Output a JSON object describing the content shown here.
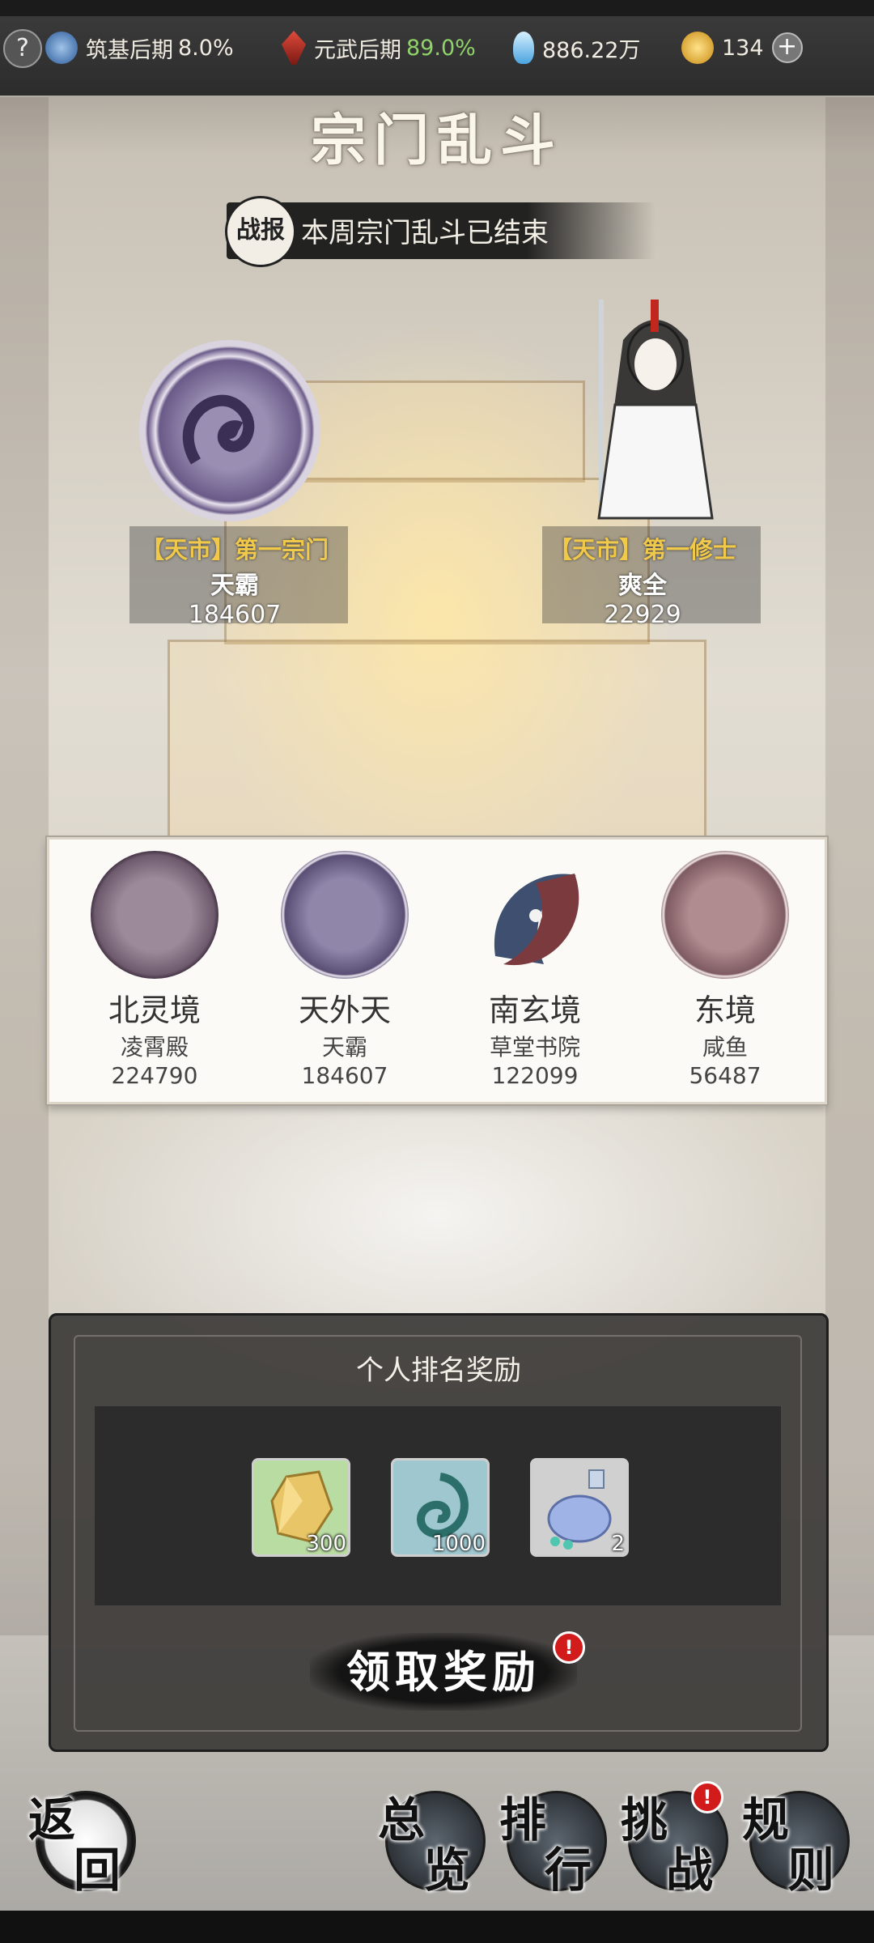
{
  "topbar": {
    "help_label": "?",
    "realm1": {
      "name": "筑基后期",
      "progress": "8.0%"
    },
    "realm2": {
      "name": "元武后期",
      "progress": "89.0%"
    },
    "spirit_stones": "886.22万",
    "jade": "134",
    "plus_label": "+"
  },
  "title": "宗门乱斗",
  "banner": {
    "seal": "战报",
    "text": "本周宗门乱斗已结束"
  },
  "champions": {
    "sect": {
      "title": "【天市】第一宗门",
      "name": "天霸",
      "score": "184607"
    },
    "cultivator": {
      "title": "【天市】第一修士",
      "name": "爽全",
      "score": "22929"
    }
  },
  "sects": [
    {
      "region": "北灵境",
      "name": "凌霄殿",
      "score": "224790",
      "color": "#6e5a6d"
    },
    {
      "region": "天外天",
      "name": "天霸",
      "score": "184607",
      "color": "#5a4e74"
    },
    {
      "region": "南玄境",
      "name": "草堂书院",
      "score": "122099",
      "color": "#3e4f70"
    },
    {
      "region": "东境",
      "name": "咸鱼",
      "score": "56487",
      "color": "#7e5a62"
    }
  ],
  "reward": {
    "title": "个人排名奖励",
    "items": [
      {
        "icon": "crystal-icon",
        "count": "300",
        "bg": "#b9dca2"
      },
      {
        "icon": "spirit-swirl-icon",
        "count": "1000",
        "bg": "#9ec7cf"
      },
      {
        "icon": "potion-bottle-icon",
        "count": "2",
        "bg": "#d0d0d0"
      }
    ],
    "claim_label": "领取奖励",
    "badge": "!"
  },
  "nav": {
    "back": [
      "返",
      "回"
    ],
    "overview": [
      "总",
      "览"
    ],
    "ranking": [
      "排",
      "行"
    ],
    "challenge": [
      "挑",
      "战"
    ],
    "rules": [
      "规",
      "则"
    ],
    "badge": "!"
  }
}
